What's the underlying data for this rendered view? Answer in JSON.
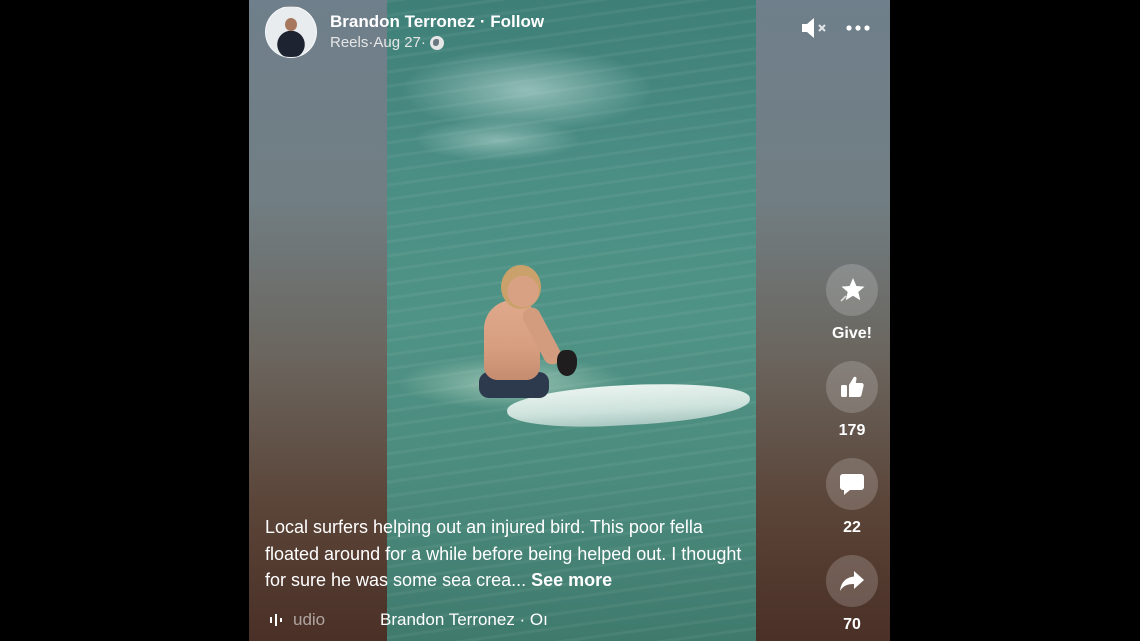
{
  "post": {
    "author": "Brandon Terronez",
    "separator": " · ",
    "follow_label": "Follow",
    "source": "Reels",
    "date": "Aug 27",
    "privacy_icon": "globe-icon"
  },
  "controls": {
    "mute_icon": "speaker-muted-icon",
    "more_icon": "more-dots-icon"
  },
  "actions": {
    "give_label": "Give!",
    "like_count": "179",
    "comment_count": "22",
    "share_count": "70"
  },
  "caption": {
    "text": "Local surfers helping out an injured bird. This poor fella floated around for a while before being helped out. I thought for sure he was some sea crea...",
    "see_more_label": "See more"
  },
  "audio": {
    "label": "udio",
    "title": "Brandon Terronez · Oı"
  },
  "colors": {
    "text": "#ffffff",
    "action_circle": "rgba(255,255,255,0.18)"
  }
}
